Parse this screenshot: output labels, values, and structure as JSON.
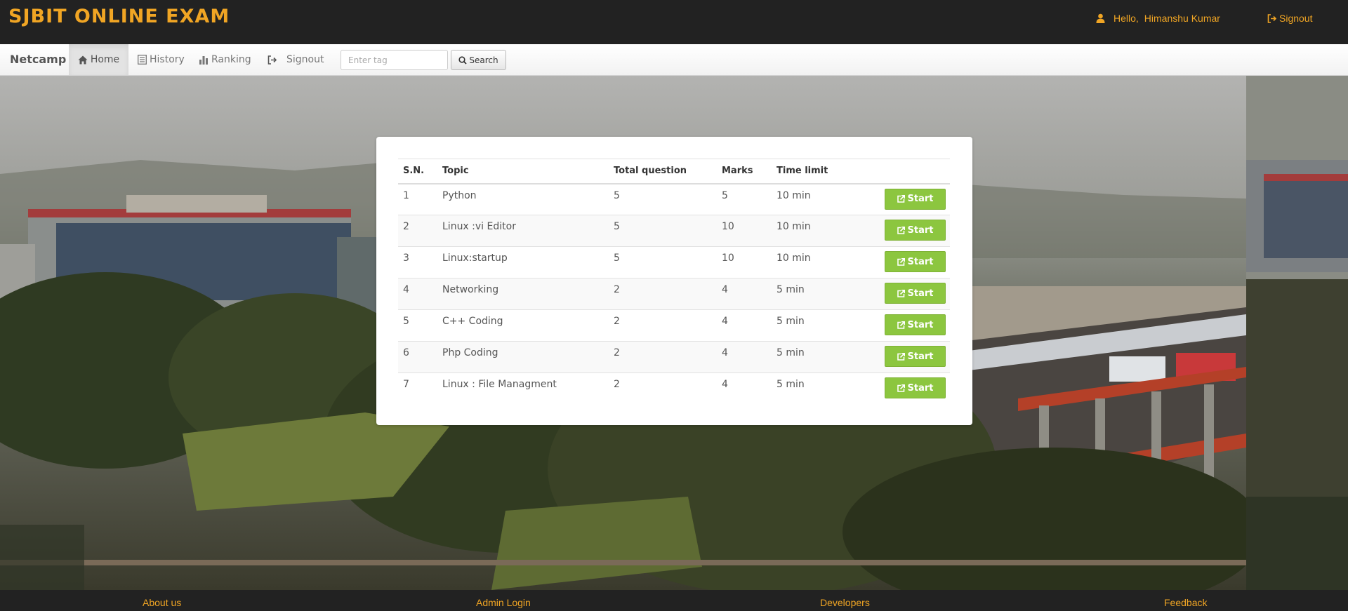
{
  "header": {
    "title": "SJBIT ONLINE EXAM",
    "hello_label": "Hello,",
    "user_name": "Himanshu Kumar",
    "signout_label": "Signout",
    "accent_color": "#f0a524"
  },
  "navbar": {
    "brand": "Netcamp",
    "items": [
      {
        "label": "Home",
        "icon": "home-icon",
        "active": true
      },
      {
        "label": "History",
        "icon": "list-icon",
        "active": false
      },
      {
        "label": "Ranking",
        "icon": "bar-chart-icon",
        "active": false
      },
      {
        "label": "Signout",
        "icon": "signout-icon",
        "active": false
      }
    ],
    "search_placeholder": "Enter tag",
    "search_value": "",
    "search_button": "Search"
  },
  "table": {
    "headers": [
      "S.N.",
      "Topic",
      "Total question",
      "Marks",
      "Time limit"
    ],
    "start_label": "Start",
    "rows": [
      {
        "sn": "1",
        "topic": "Python",
        "total": "5",
        "marks": "5",
        "time": "10 min"
      },
      {
        "sn": "2",
        "topic": "Linux :vi Editor",
        "total": "5",
        "marks": "10",
        "time": "10 min"
      },
      {
        "sn": "3",
        "topic": "Linux:startup",
        "total": "5",
        "marks": "10",
        "time": "10 min"
      },
      {
        "sn": "4",
        "topic": "Networking",
        "total": "2",
        "marks": "4",
        "time": "5 min"
      },
      {
        "sn": "5",
        "topic": "C++ Coding",
        "total": "2",
        "marks": "4",
        "time": "5 min"
      },
      {
        "sn": "6",
        "topic": "Php Coding",
        "total": "2",
        "marks": "4",
        "time": "5 min"
      },
      {
        "sn": "7",
        "topic": "Linux : File Managment",
        "total": "2",
        "marks": "4",
        "time": "5 min"
      }
    ],
    "button_color": "#8cc63f"
  },
  "footer": {
    "links": [
      "About us",
      "Admin Login",
      "Developers",
      "Feedback"
    ]
  }
}
